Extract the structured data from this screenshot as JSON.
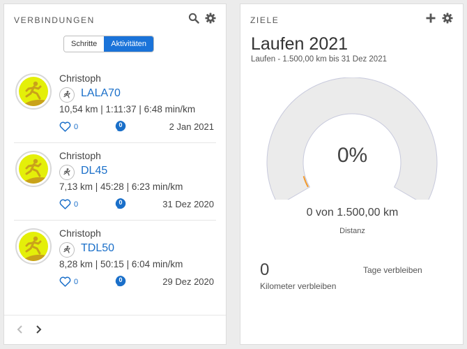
{
  "connections": {
    "title": "VERBINDUNGEN",
    "icons": [
      "search-icon",
      "gear-icon"
    ],
    "toggle": {
      "option1": "Schritte",
      "option2": "Aktivitäten",
      "active": "Aktivitäten"
    },
    "activities": [
      {
        "user": "Christoph",
        "title": "LALA70",
        "stats": "10,54 km | 1:11:37 | 6:48 min/km",
        "likes": "0",
        "comments": "0",
        "date": "2 Jan 2021"
      },
      {
        "user": "Christoph",
        "title": "DL45",
        "stats": "7,13 km | 45:28 | 6:23 min/km",
        "likes": "0",
        "comments": "0",
        "date": "31 Dez 2020"
      },
      {
        "user": "Christoph",
        "title": "TDL50",
        "stats": "8,28 km | 50:15 | 6:04 min/km",
        "likes": "0",
        "comments": "0",
        "date": "29 Dez 2020"
      }
    ]
  },
  "goals": {
    "title": "ZIELE",
    "icons": [
      "plus-icon",
      "gear-icon"
    ],
    "goal_title": "Laufen 2021",
    "goal_subtitle": "Laufen - 1.500,00 km bis 31 Dez 2021",
    "progress_fraction": 0,
    "percent_label": "0%",
    "amount_label": "0 von 1.500,00 km",
    "metric_label": "Distanz",
    "km_remaining_value": "0",
    "km_remaining_label": "Kilometer verbleiben",
    "days_remaining_label": "Tage verbleiben"
  },
  "colors": {
    "accent": "#1a73d9",
    "link": "#1a6fc9",
    "gauge_track": "#ebebeb",
    "gauge_progress": "#f29a2e",
    "avatar_bg": "#e4ef09"
  }
}
